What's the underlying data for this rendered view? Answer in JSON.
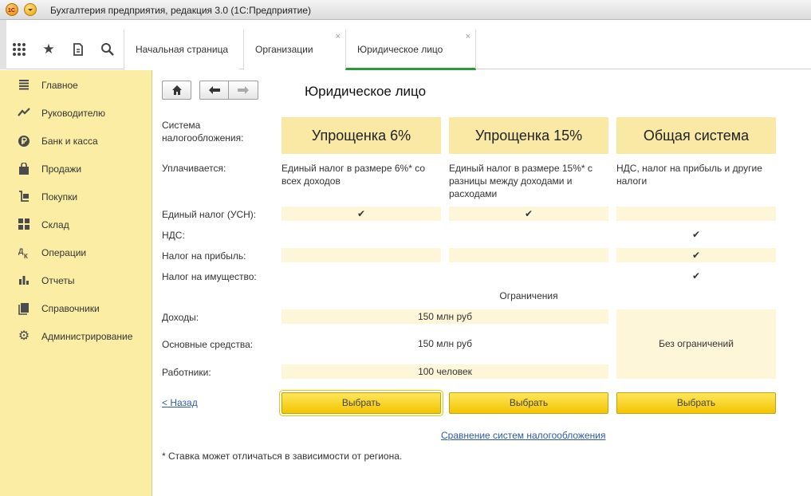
{
  "window": {
    "title": "Бухгалтерия предприятия, редакция 3.0  (1С:Предприятие)"
  },
  "tabs": [
    {
      "label": "Начальная страница",
      "closable": false
    },
    {
      "label": "Организации",
      "closable": true
    },
    {
      "label": "Юридическое лицо",
      "closable": true,
      "active": true
    }
  ],
  "tab_close_glyph": "×",
  "sidebar": {
    "items": [
      {
        "label": "Главное",
        "icon": "menu-icon"
      },
      {
        "label": "Руководителю",
        "icon": "trend-icon"
      },
      {
        "label": "Банк и касса",
        "icon": "ruble-icon"
      },
      {
        "label": "Продажи",
        "icon": "bag-icon"
      },
      {
        "label": "Покупки",
        "icon": "cart-icon"
      },
      {
        "label": "Склад",
        "icon": "warehouse-icon"
      },
      {
        "label": "Операции",
        "icon": "operations-icon"
      },
      {
        "label": "Отчеты",
        "icon": "bar-chart-icon"
      },
      {
        "label": "Справочники",
        "icon": "book-icon"
      },
      {
        "label": "Администрирование",
        "icon": "gear-icon"
      }
    ]
  },
  "form": {
    "title": "Юридическое лицо",
    "labels": {
      "tax_system": "Система\nналогообложения:",
      "pays": "Уплачивается:",
      "usn": "Единый налог (УСН):",
      "vat": "НДС:",
      "profit": "Налог на прибыль:",
      "property": "Налог на имущество:",
      "income": "Доходы:",
      "fixed_assets": "Основные средства:",
      "workers": "Работники:"
    },
    "columns": [
      {
        "name": "Упрощенка 6%",
        "pays": "Единый налог в размере 6%* со всех доходов",
        "usn": "✔",
        "vat": "",
        "profit": "",
        "property": ""
      },
      {
        "name": "Упрощенка 15%",
        "pays": "Единый налог в размере 15%* с разницы между доходами и расходами",
        "usn": "✔",
        "vat": "",
        "profit": "",
        "property": ""
      },
      {
        "name": "Общая система",
        "pays": "НДС, налог на прибыль и другие налоги",
        "usn": "",
        "vat": "✔",
        "profit": "✔",
        "property": "✔"
      }
    ],
    "limits_title": "Ограничения",
    "limits": {
      "income": "150 млн руб",
      "fixed_assets": "150 млн руб",
      "workers": "100 человек",
      "general": "Без ограничений"
    },
    "choose_label": "Выбрать",
    "back_link": "< Назад",
    "compare_link": "Сравнение систем налогообложения",
    "footnote": "* Ставка может отличаться в зависимости от региона."
  },
  "colors": {
    "accent_green": "#2a9a3a",
    "sidebar_bg": "#fbeea4",
    "button_yellow": "#f3c400",
    "column_header_bg": "#f9e9a5"
  }
}
